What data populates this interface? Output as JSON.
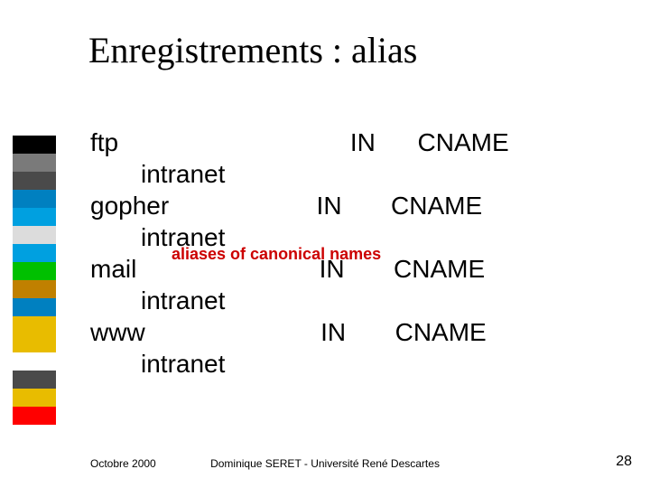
{
  "title": "Enregistrements : alias",
  "records": [
    {
      "name": "ftp",
      "class": "IN",
      "type": "CNAME",
      "target": "intranet",
      "pad1": "                                 ",
      "pad2": "      "
    },
    {
      "name": "gopher",
      "class": "IN",
      "type": "CNAME",
      "target": "intranet",
      "pad1": "                     ",
      "pad2": "       "
    },
    {
      "name": "mail",
      "class": "IN",
      "type": "CNAME",
      "target": "intranet",
      "pad1": "                          ",
      "pad2": "       "
    },
    {
      "name": "www",
      "class": "IN",
      "type": "CNAME",
      "target": "intranet",
      "pad1": "                         ",
      "pad2": "       "
    }
  ],
  "annotation": "aliases of canonical names",
  "footer": {
    "left": "Octobre 2000",
    "center": "Dominique SERET - Université René Descartes",
    "page": "28"
  },
  "bands": [
    "#000000",
    "#7a7a7a",
    "#4a4a4a",
    "#0080c0",
    "#00a0e0",
    "#dcdcdc",
    "#00a0e0",
    "#00c000",
    "#c08000",
    "#0080c0",
    "#e8bc00",
    "#e8bc00",
    "#ffffff",
    "#4a4a4a",
    "#e8bc00",
    "#ff0000"
  ]
}
